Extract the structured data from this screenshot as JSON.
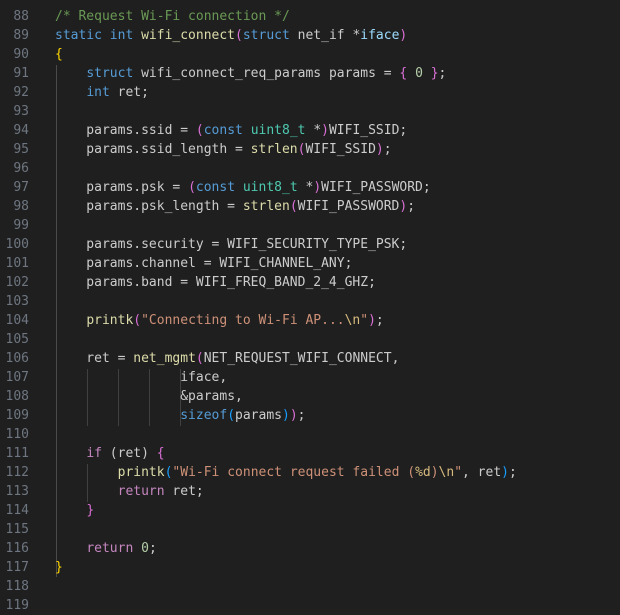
{
  "editor": {
    "lines": [
      {
        "n": "88",
        "tokens": [
          [
            "/* Request Wi-Fi connection */",
            "t-comment"
          ]
        ]
      },
      {
        "n": "89",
        "tokens": [
          [
            "static int ",
            "t-kw"
          ],
          [
            "wifi_connect",
            "t-fn"
          ],
          [
            "(",
            "t-bracket2"
          ],
          [
            "struct ",
            "t-kw"
          ],
          [
            "net_if ",
            "t-plain"
          ],
          [
            "*",
            "t-plain"
          ],
          [
            "iface",
            "t-var"
          ],
          [
            ")",
            "t-bracket2"
          ]
        ]
      },
      {
        "n": "90",
        "tokens": [
          [
            "{",
            "t-bracket1"
          ]
        ]
      },
      {
        "n": "91",
        "tokens": [
          [
            "    ",
            "t-plain"
          ],
          [
            "struct ",
            "t-kw"
          ],
          [
            "wifi_connect_req_params ",
            "t-plain"
          ],
          [
            "params",
            "t-plain"
          ],
          [
            " = ",
            "t-plain"
          ],
          [
            "{",
            "t-bracket2"
          ],
          [
            " ",
            "t-plain"
          ],
          [
            "0",
            "t-num"
          ],
          [
            " ",
            "t-plain"
          ],
          [
            "}",
            "t-bracket2"
          ],
          [
            ";",
            "t-plain"
          ]
        ]
      },
      {
        "n": "92",
        "tokens": [
          [
            "    ",
            "t-plain"
          ],
          [
            "int ",
            "t-kw"
          ],
          [
            "ret;",
            "t-plain"
          ]
        ]
      },
      {
        "n": "93",
        "tokens": []
      },
      {
        "n": "94",
        "tokens": [
          [
            "    params.ssid = ",
            "t-plain"
          ],
          [
            "(",
            "t-bracket2"
          ],
          [
            "const ",
            "t-kw"
          ],
          [
            "uint8_t ",
            "t-type"
          ],
          [
            "*",
            "t-plain"
          ],
          [
            ")",
            "t-bracket2"
          ],
          [
            "WIFI_SSID;",
            "t-plain"
          ]
        ]
      },
      {
        "n": "95",
        "tokens": [
          [
            "    params.ssid_length = ",
            "t-plain"
          ],
          [
            "strlen",
            "t-fn"
          ],
          [
            "(",
            "t-bracket2"
          ],
          [
            "WIFI_SSID",
            "t-plain"
          ],
          [
            ")",
            "t-bracket2"
          ],
          [
            ";",
            "t-plain"
          ]
        ]
      },
      {
        "n": "96",
        "tokens": []
      },
      {
        "n": "97",
        "tokens": [
          [
            "    params.psk = ",
            "t-plain"
          ],
          [
            "(",
            "t-bracket2"
          ],
          [
            "const ",
            "t-kw"
          ],
          [
            "uint8_t ",
            "t-type"
          ],
          [
            "*",
            "t-plain"
          ],
          [
            ")",
            "t-bracket2"
          ],
          [
            "WIFI_PASSWORD;",
            "t-plain"
          ]
        ]
      },
      {
        "n": "98",
        "tokens": [
          [
            "    params.psk_length = ",
            "t-plain"
          ],
          [
            "strlen",
            "t-fn"
          ],
          [
            "(",
            "t-bracket2"
          ],
          [
            "WIFI_PASSWORD",
            "t-plain"
          ],
          [
            ")",
            "t-bracket2"
          ],
          [
            ";",
            "t-plain"
          ]
        ]
      },
      {
        "n": "99",
        "tokens": []
      },
      {
        "n": "100",
        "tokens": [
          [
            "    params.security = WIFI_SECURITY_TYPE_PSK;",
            "t-plain"
          ]
        ]
      },
      {
        "n": "101",
        "tokens": [
          [
            "    params.channel = WIFI_CHANNEL_ANY;",
            "t-plain"
          ]
        ]
      },
      {
        "n": "102",
        "tokens": [
          [
            "    params.band = WIFI_FREQ_BAND_2_4_GHZ;",
            "t-plain"
          ]
        ]
      },
      {
        "n": "103",
        "tokens": []
      },
      {
        "n": "104",
        "tokens": [
          [
            "    ",
            "t-plain"
          ],
          [
            "printk",
            "t-fn"
          ],
          [
            "(",
            "t-bracket2"
          ],
          [
            "\"Connecting to Wi-Fi AP...",
            "t-str"
          ],
          [
            "\\n",
            "t-esc"
          ],
          [
            "\"",
            "t-str"
          ],
          [
            ")",
            "t-bracket2"
          ],
          [
            ";",
            "t-plain"
          ]
        ]
      },
      {
        "n": "105",
        "tokens": []
      },
      {
        "n": "106",
        "tokens": [
          [
            "    ret = ",
            "t-plain"
          ],
          [
            "net_mgmt",
            "t-fn"
          ],
          [
            "(",
            "t-bracket2"
          ],
          [
            "NET_REQUEST_WIFI_CONNECT,",
            "t-plain"
          ]
        ]
      },
      {
        "n": "107",
        "tokens": [
          [
            "                ",
            "t-plain"
          ],
          [
            "iface,",
            "t-plain"
          ]
        ]
      },
      {
        "n": "108",
        "tokens": [
          [
            "                ",
            "t-plain"
          ],
          [
            "&params,",
            "t-plain"
          ]
        ]
      },
      {
        "n": "109",
        "tokens": [
          [
            "                ",
            "t-plain"
          ],
          [
            "sizeof",
            "t-kw"
          ],
          [
            "(",
            "t-bracket3"
          ],
          [
            "params",
            "t-plain"
          ],
          [
            ")",
            "t-bracket3"
          ],
          [
            ")",
            "t-bracket2"
          ],
          [
            ";",
            "t-plain"
          ]
        ]
      },
      {
        "n": "110",
        "tokens": []
      },
      {
        "n": "111",
        "tokens": [
          [
            "    ",
            "t-plain"
          ],
          [
            "if ",
            "t-ctl"
          ],
          [
            "(ret) ",
            "t-plain"
          ],
          [
            "{",
            "t-bracket2"
          ]
        ]
      },
      {
        "n": "112",
        "tokens": [
          [
            "        ",
            "t-plain"
          ],
          [
            "printk",
            "t-fn"
          ],
          [
            "(",
            "t-bracket3"
          ],
          [
            "\"Wi-Fi connect request failed (",
            "t-str"
          ],
          [
            "%d",
            "t-esc"
          ],
          [
            ")",
            "t-str"
          ],
          [
            "\\n",
            "t-esc"
          ],
          [
            "\"",
            "t-str"
          ],
          [
            ", ret",
            "t-plain"
          ],
          [
            ")",
            "t-bracket3"
          ],
          [
            ";",
            "t-plain"
          ]
        ]
      },
      {
        "n": "113",
        "tokens": [
          [
            "        ",
            "t-plain"
          ],
          [
            "return ",
            "t-ctl"
          ],
          [
            "ret;",
            "t-plain"
          ]
        ]
      },
      {
        "n": "114",
        "tokens": [
          [
            "    ",
            "t-plain"
          ],
          [
            "}",
            "t-bracket2"
          ]
        ]
      },
      {
        "n": "115",
        "tokens": []
      },
      {
        "n": "116",
        "tokens": [
          [
            "    ",
            "t-plain"
          ],
          [
            "return ",
            "t-ctl"
          ],
          [
            "0",
            "t-num"
          ],
          [
            ";",
            "t-plain"
          ]
        ]
      },
      {
        "n": "117",
        "tokens": [
          [
            "}",
            "t-bracket1"
          ]
        ]
      },
      {
        "n": "118",
        "tokens": []
      },
      {
        "n": "119",
        "tokens": []
      }
    ]
  },
  "colors": {
    "background": "#1f1f1f",
    "line_number": "#6e7681",
    "comment": "#6a9955",
    "keyword": "#569cd6",
    "control": "#c586c0",
    "type": "#4ec9b0",
    "function": "#dcdcaa",
    "string": "#ce9178",
    "escape": "#d7ba7d",
    "number": "#b5cea8"
  }
}
